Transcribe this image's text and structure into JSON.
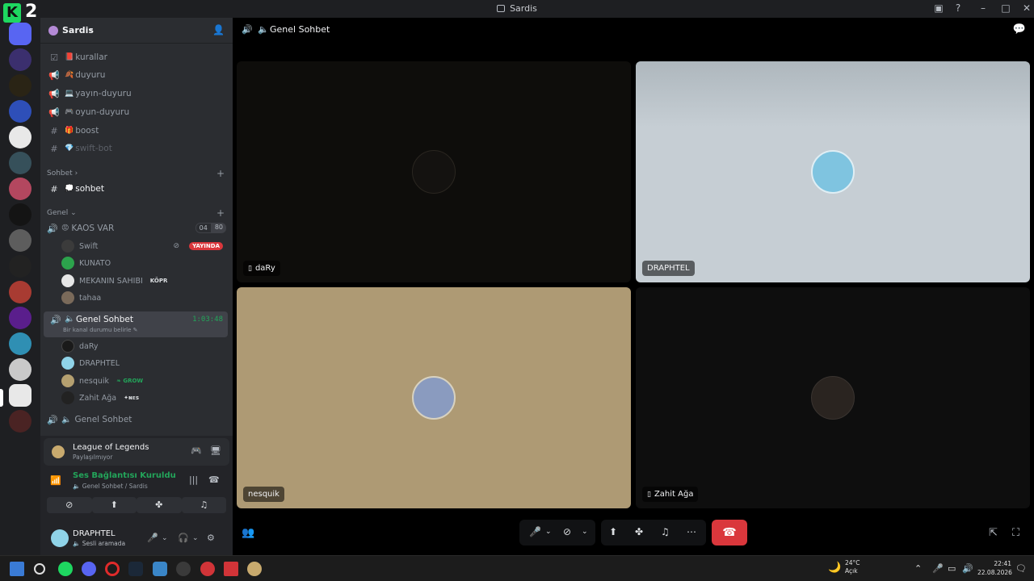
{
  "window": {
    "title": "Sardis",
    "k2_logo": "K",
    "k2_number": "2"
  },
  "guild": {
    "name": "Sardis"
  },
  "channels": [
    {
      "label": "kurallar",
      "emoji": "📕",
      "icon": "rules-icon"
    },
    {
      "label": "duyuru",
      "emoji": "🍂",
      "icon": "announcement-icon"
    },
    {
      "label": "yayın-duyuru",
      "emoji": "💻",
      "icon": "announcement-icon"
    },
    {
      "label": "oyun-duyuru",
      "emoji": "🎮",
      "icon": "announcement-icon"
    },
    {
      "label": "boost",
      "emoji": "🎁",
      "icon": "hash-icon"
    },
    {
      "label": "swift-bot",
      "emoji": "💎",
      "icon": "hash-icon"
    }
  ],
  "categories": {
    "sohbet": "Sohbet",
    "genel": "Genel"
  },
  "sohbet_channel": {
    "label": "sohbet",
    "emoji": "💭"
  },
  "kaos": {
    "label": "KAOS VAR",
    "emoji": "😡",
    "count_a": "04",
    "count_b": "80",
    "members": [
      {
        "name": "Swift",
        "live": "YAYINDA"
      },
      {
        "name": "KUNATO"
      },
      {
        "name": "MEKANIN SAHIBI",
        "tag": "KÖPR"
      },
      {
        "name": "tahaa"
      }
    ]
  },
  "genel_sohbet": {
    "label": "Genel Sohbet",
    "timer": "1:03:48",
    "status": "Bir kanal durumu belirle",
    "members": [
      {
        "name": "daRy"
      },
      {
        "name": "DRAPHTEL"
      },
      {
        "name": "nesquik",
        "tag": "GROW"
      },
      {
        "name": "Zahit Ağa",
        "tag": "ɴᴇs"
      }
    ]
  },
  "genel_sohbet_2": {
    "label": "Genel Sohbet"
  },
  "activity": {
    "title": "League of Legends",
    "subtitle": "Paylaşılmıyor"
  },
  "voice_connection": {
    "status": "Ses Bağlantısı Kuruldu",
    "location": "Genel Sohbet / Sardis"
  },
  "user": {
    "name": "DRAPHTEL",
    "status": "Sesli aramada"
  },
  "stage": {
    "channel_name": "Genel Sohbet",
    "tiles": [
      {
        "name": "daRy",
        "mobile": true
      },
      {
        "name": "DRAPHTEL",
        "mobile": false
      },
      {
        "name": "nesquik",
        "mobile": false
      },
      {
        "name": "Zahit Ağa",
        "mobile": true
      }
    ]
  },
  "taskbar": {
    "weather_temp": "24°C",
    "weather_desc": "Açık",
    "time": "22:41",
    "date": "22.08.2026"
  },
  "colors": {
    "accent_green": "#23a55a",
    "danger": "#da373c",
    "live": "#da373c",
    "k2": "#1ed760"
  }
}
